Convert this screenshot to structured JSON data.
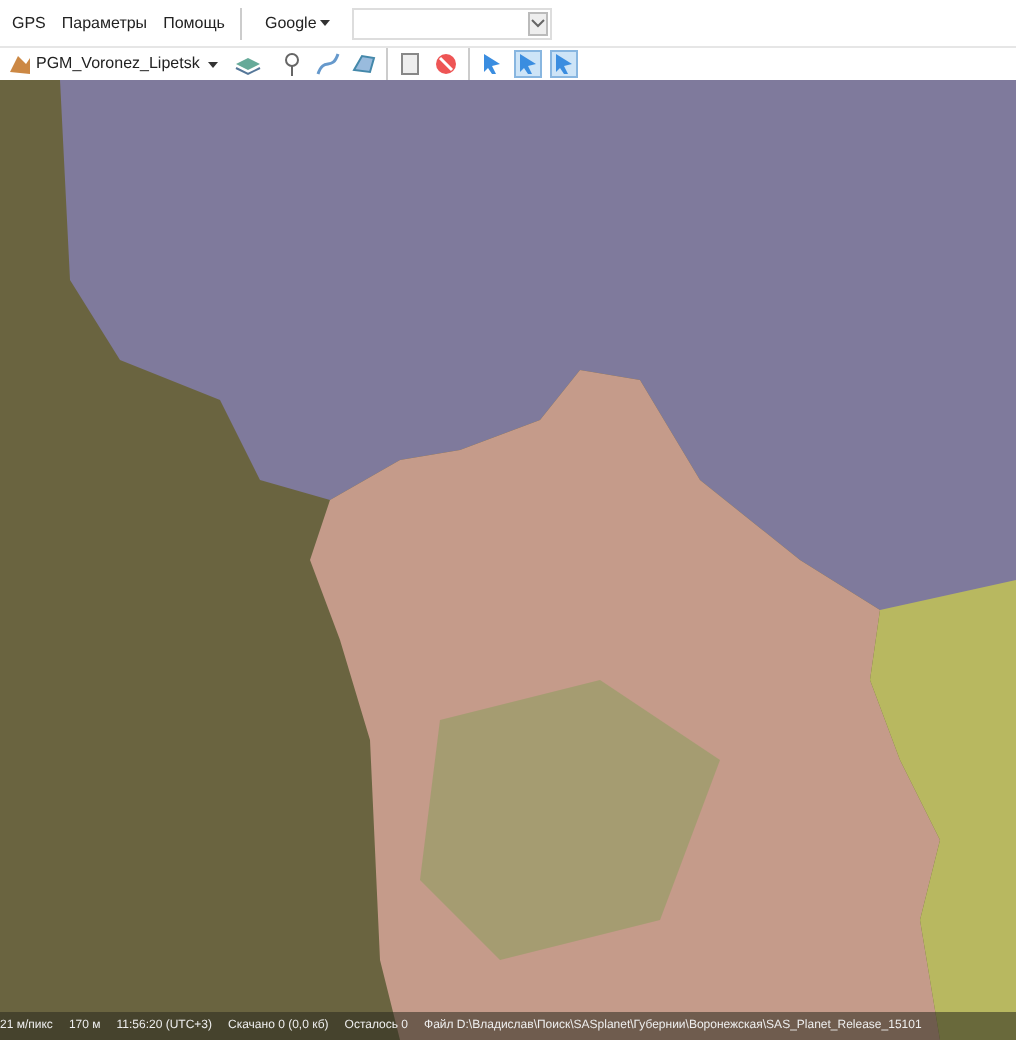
{
  "menu": [
    "GPS",
    "Параметры",
    "Помощь"
  ],
  "search": {
    "engine": "Google"
  },
  "toolbar": {
    "map_source": "PGM_Voronez_Lipetsk",
    "tools": [
      {
        "kind": "marker",
        "selected": false
      },
      {
        "kind": "path",
        "selected": false
      },
      {
        "kind": "polygon",
        "selected": false
      },
      {
        "kind": "note",
        "selected": false
      },
      {
        "kind": "forbid",
        "selected": false
      },
      {
        "kind": "cursor",
        "selected": false
      },
      {
        "kind": "cursor",
        "selected": true
      },
      {
        "kind": "cursor",
        "selected": true
      }
    ]
  },
  "status_bar": [
    "21 м/пикс",
    "170 м",
    "11:56:20 (UTC+3)",
    "Скачано 0 (0,0 кб)",
    "Осталось 0",
    "Файл D:\\Владислав\\Поиск\\SASplanet\\Губернии\\Воронежская\\SAS_Planet_Release_15101"
  ]
}
